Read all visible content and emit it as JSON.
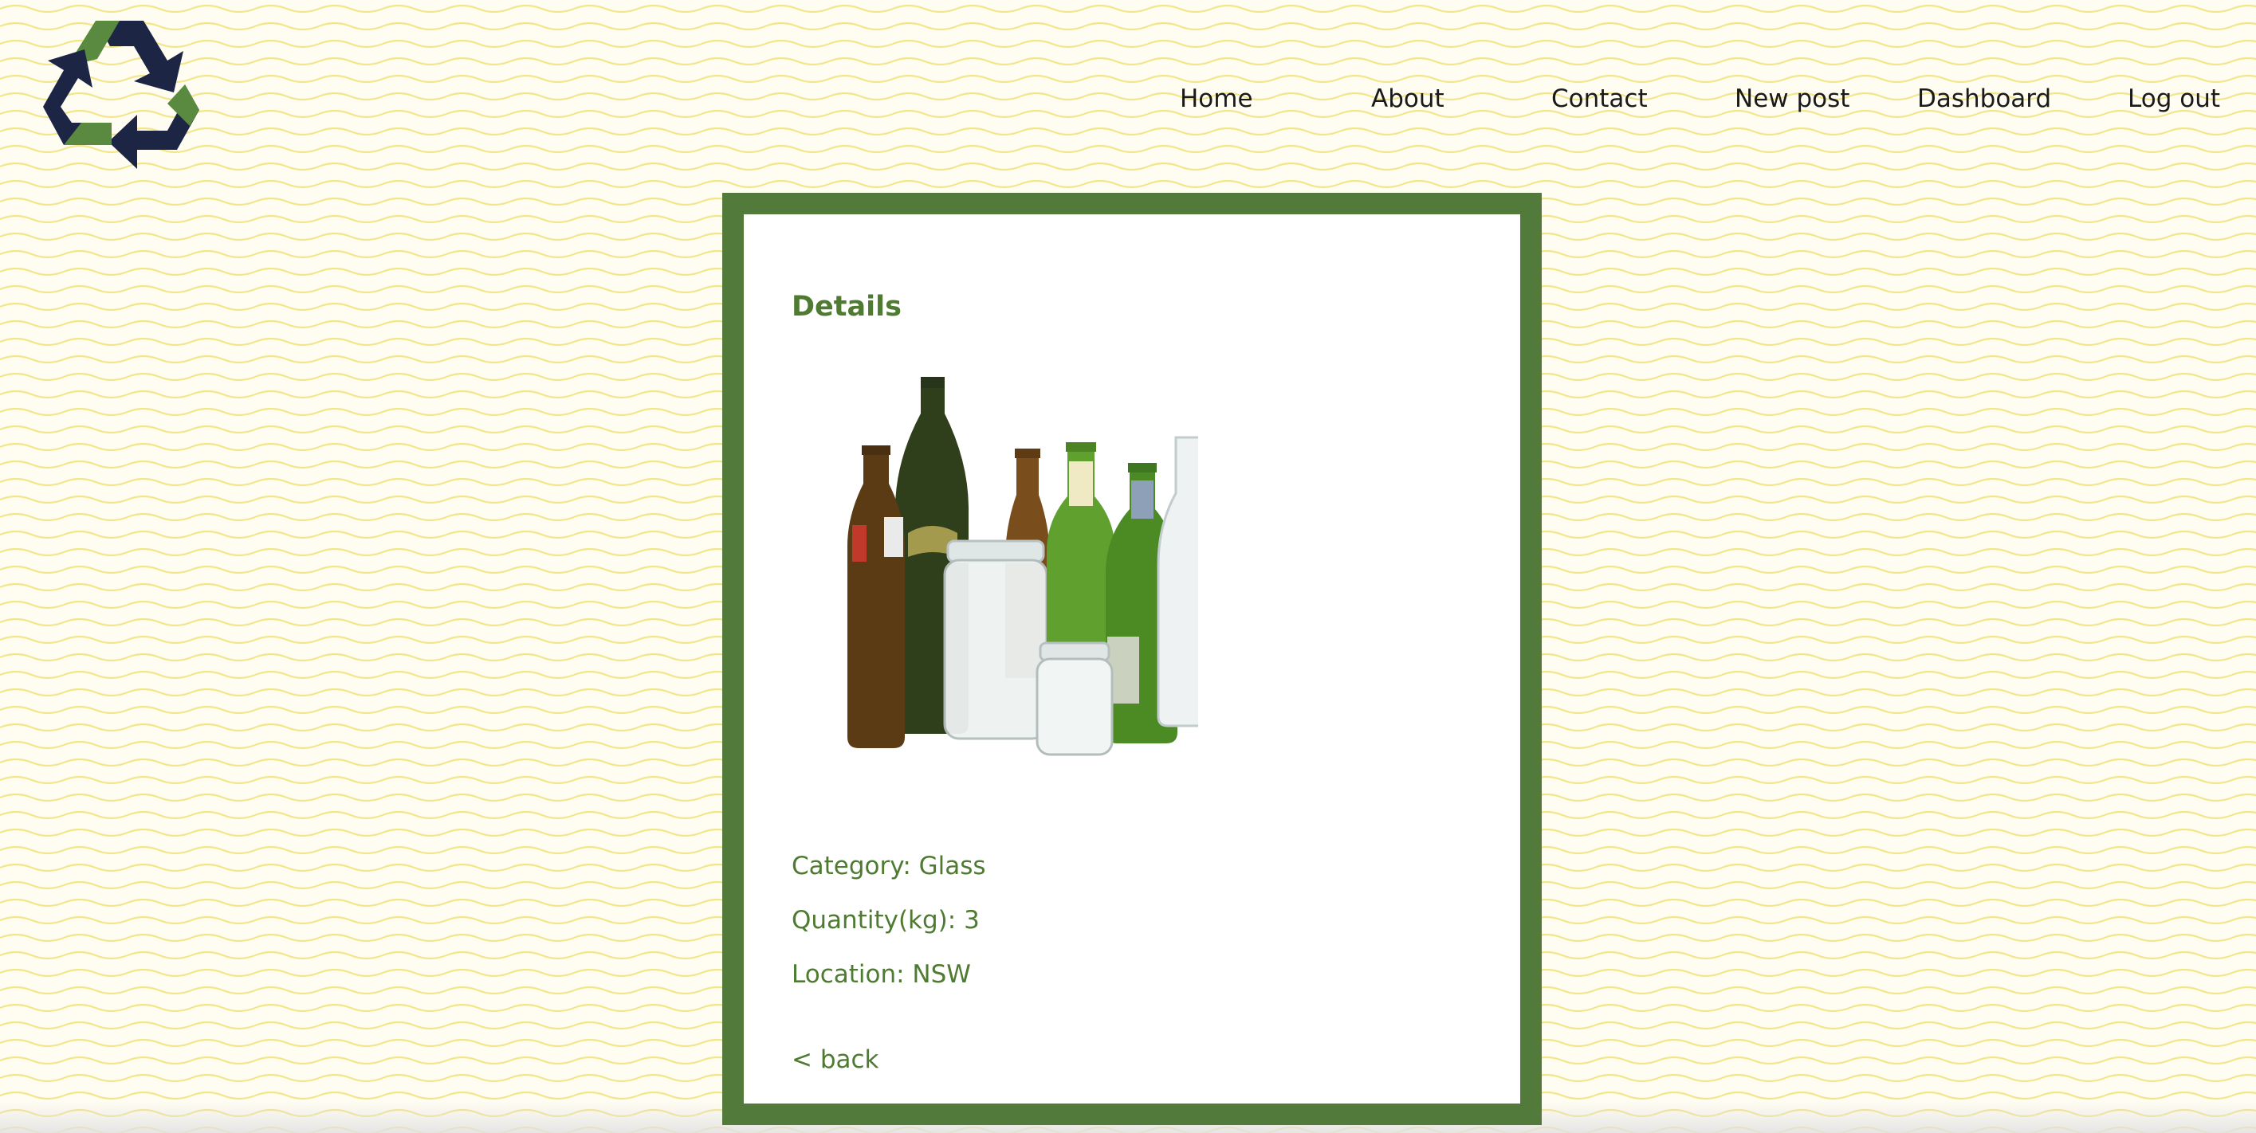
{
  "brand": {
    "logo_icon": "recycle-icon",
    "colors": {
      "green": "#5a8a3f",
      "navy": "#1c2644"
    }
  },
  "nav": {
    "items": [
      {
        "label": "Home"
      },
      {
        "label": "About"
      },
      {
        "label": "Contact"
      },
      {
        "label": "New post"
      },
      {
        "label": "Dashboard"
      },
      {
        "label": "Log out"
      }
    ]
  },
  "details": {
    "title": "Details",
    "image_icon": "glass-bottles-image",
    "category": "Category: Glass",
    "quantity": "Quantity(kg): 3",
    "location": "Location: NSW",
    "back_label": "< back"
  },
  "theme": {
    "card_border": "#527a3b",
    "text_green": "#4f7a31",
    "wave_color": "#f5e98f",
    "background": "#fffdf0"
  }
}
